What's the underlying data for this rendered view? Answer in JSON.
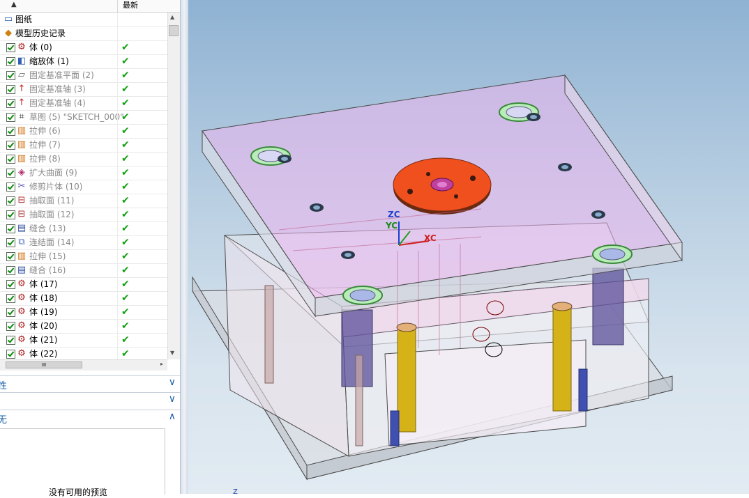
{
  "navigator": {
    "header": {
      "sort_arrow": "▲",
      "column_latest": "最新"
    },
    "items": [
      {
        "label": "图纸",
        "icon": "drawing-icon",
        "indent": "top"
      },
      {
        "label": "模型历史记录",
        "icon": "history-icon",
        "indent": "top"
      },
      {
        "label": "体 (0)",
        "icon": "body-icon",
        "dim": false,
        "status": "✔"
      },
      {
        "label": "缩放体 (1)",
        "icon": "scale-body-icon",
        "dim": false,
        "status": "✔"
      },
      {
        "label": "固定基准平面 (2)",
        "icon": "datum-plane-icon",
        "dim": true,
        "status": "✔"
      },
      {
        "label": "固定基准轴 (3)",
        "icon": "datum-axis-icon",
        "dim": true,
        "status": "✔"
      },
      {
        "label": "固定基准轴 (4)",
        "icon": "datum-axis-icon",
        "dim": true,
        "status": "✔"
      },
      {
        "label": "草图 (5) \"SKETCH_000\"",
        "icon": "sketch-icon",
        "dim": true,
        "status": "✔"
      },
      {
        "label": "拉伸 (6)",
        "icon": "extrude-icon",
        "dim": true,
        "status": "✔"
      },
      {
        "label": "拉伸 (7)",
        "icon": "extrude-icon",
        "dim": true,
        "status": "✔"
      },
      {
        "label": "拉伸 (8)",
        "icon": "extrude-icon",
        "dim": true,
        "status": "✔"
      },
      {
        "label": "扩大曲面 (9)",
        "icon": "enlarge-surface-icon",
        "dim": true,
        "status": "✔"
      },
      {
        "label": "修剪片体 (10)",
        "icon": "trim-sheet-icon",
        "dim": true,
        "status": "✔"
      },
      {
        "label": "抽取面 (11)",
        "icon": "extract-face-icon",
        "dim": true,
        "status": "✔"
      },
      {
        "label": "抽取面 (12)",
        "icon": "extract-face-icon",
        "dim": true,
        "status": "✔"
      },
      {
        "label": "缝合 (13)",
        "icon": "sew-icon",
        "dim": true,
        "status": "✔"
      },
      {
        "label": "连结面 (14)",
        "icon": "join-face-icon",
        "dim": true,
        "status": "✔"
      },
      {
        "label": "拉伸 (15)",
        "icon": "extrude-icon",
        "dim": true,
        "status": "✔"
      },
      {
        "label": "缝合 (16)",
        "icon": "sew-icon",
        "dim": true,
        "status": "✔"
      },
      {
        "label": "体 (17)",
        "icon": "body-icon",
        "dim": false,
        "status": "✔"
      },
      {
        "label": "体 (18)",
        "icon": "body-icon",
        "dim": false,
        "status": "✔"
      },
      {
        "label": "体 (19)",
        "icon": "body-icon",
        "dim": false,
        "status": "✔"
      },
      {
        "label": "体 (20)",
        "icon": "body-icon",
        "dim": false,
        "status": "✔"
      },
      {
        "label": "体 (21)",
        "icon": "body-icon",
        "dim": false,
        "status": "✔"
      },
      {
        "label": "体 (22)",
        "icon": "body-icon",
        "dim": false,
        "status": "✔"
      }
    ],
    "hscroll_grip": "III",
    "sections": [
      {
        "title": "性",
        "chevron": "∨"
      },
      {
        "title": "",
        "chevron": "∨"
      },
      {
        "title": "无",
        "chevron": "∧"
      }
    ],
    "preview_message": "没有可用的预览"
  },
  "viewport": {
    "csys": {
      "zc": "ZC",
      "yc": "YC",
      "xc": "XC"
    },
    "origin_label": "Z"
  }
}
